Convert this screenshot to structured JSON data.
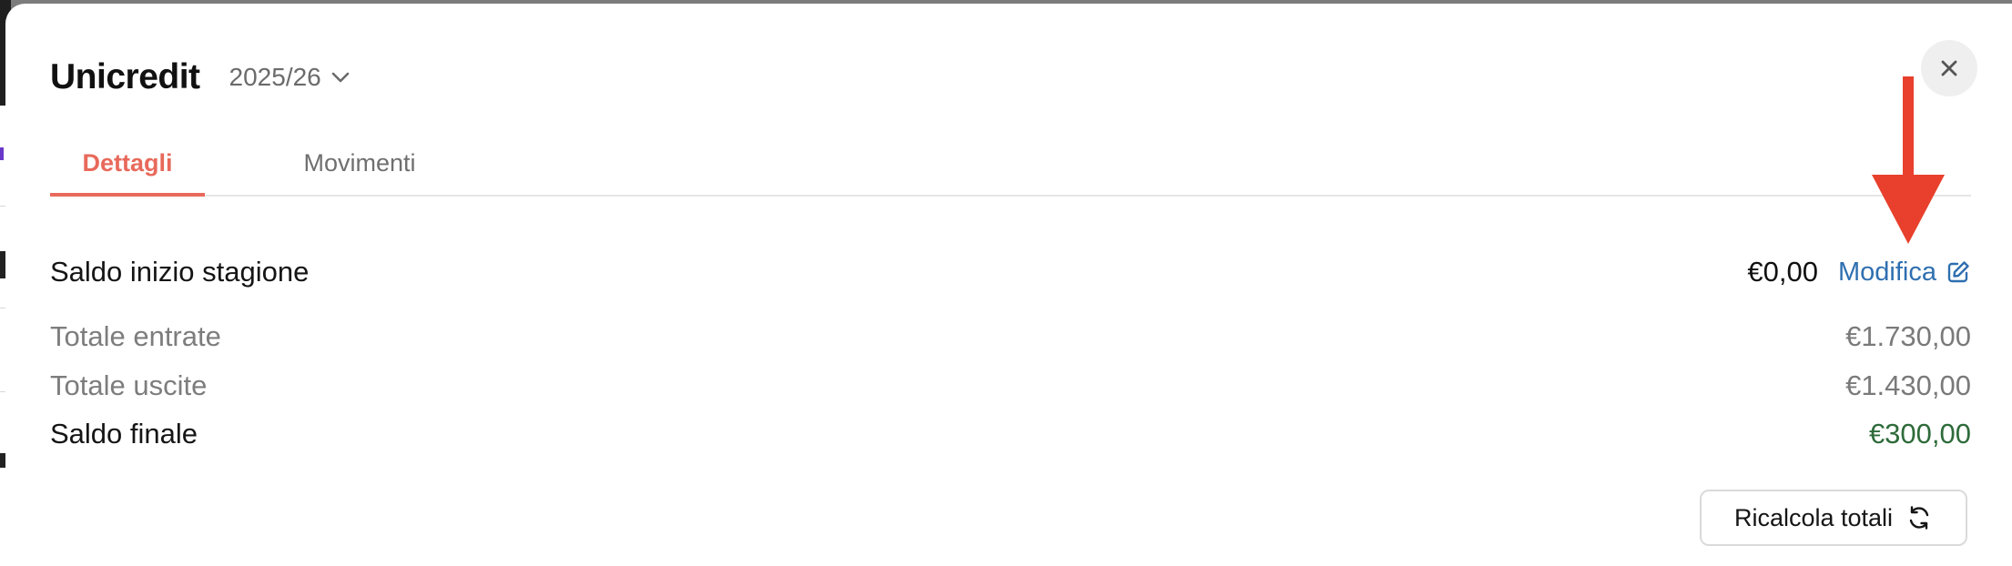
{
  "header": {
    "title": "Unicredit",
    "season": "2025/26"
  },
  "tabs": [
    {
      "label": "Dettagli",
      "active": true
    },
    {
      "label": "Movimenti",
      "active": false
    }
  ],
  "summary": {
    "opening_balance": {
      "label": "Saldo inizio stagione",
      "value": "€0,00",
      "edit_label": "Modifica"
    },
    "total_income": {
      "label": "Totale entrate",
      "value": "€1.730,00"
    },
    "total_expenses": {
      "label": "Totale uscite",
      "value": "€1.430,00"
    },
    "final_balance": {
      "label": "Saldo finale",
      "value": "€300,00"
    }
  },
  "actions": {
    "recalculate_label": "Ricalcola totali"
  },
  "icons": {
    "season_dropdown": "chevron-down-icon",
    "close": "close-icon",
    "edit": "edit-icon",
    "recalculate": "refresh-icon",
    "annotation": "red-arrow-down"
  },
  "colors": {
    "accent_tab": "#e8695b",
    "link": "#2f6fb0",
    "positive": "#2e6b3a",
    "annotation_arrow": "#e8402c"
  }
}
